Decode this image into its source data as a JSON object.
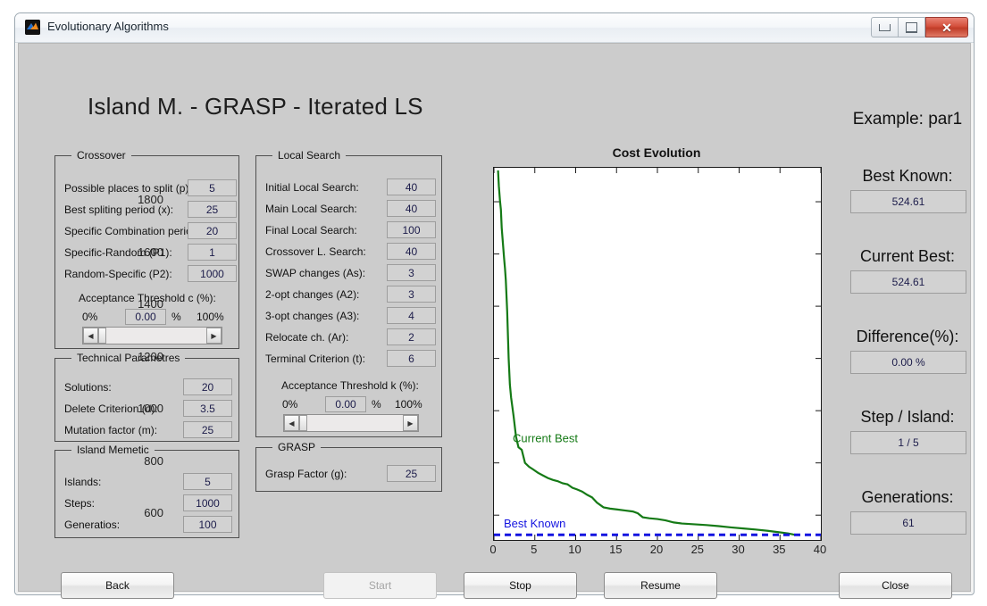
{
  "window": {
    "title": "Evolutionary Algorithms",
    "icon": "matlab-icon",
    "minimize": "minimize-icon",
    "maximize": "maximize-icon",
    "close": "close-icon"
  },
  "heading": "Island M. - GRASP - Iterated LS",
  "example": "Example: par1",
  "crossover": {
    "legend": "Crossover",
    "rows": [
      {
        "label": "Possible places to split (p):",
        "value": "5"
      },
      {
        "label": "Best spliting period (x):",
        "value": "25"
      },
      {
        "label": "Specific Combination period",
        "value": "20"
      },
      {
        "label": "Specific-Random (P1):",
        "value": "1"
      },
      {
        "label": "Random-Specific (P2):",
        "value": "1000"
      }
    ],
    "slider": {
      "title": "Acceptance Threshold c (%):",
      "min": "0%",
      "max": "100%",
      "value": "0.00",
      "unit": "%"
    }
  },
  "technical": {
    "legend": "Technical Parametres",
    "rows": [
      {
        "label": "Solutions:",
        "value": "20"
      },
      {
        "label": "Delete Criterion (d):",
        "value": "3.5"
      },
      {
        "label": "Mutation factor (m):",
        "value": "25"
      }
    ]
  },
  "island": {
    "legend": "Island Memetic",
    "rows": [
      {
        "label": "Islands:",
        "value": "5"
      },
      {
        "label": "Steps:",
        "value": "1000"
      },
      {
        "label": "Generatios:",
        "value": "100"
      }
    ]
  },
  "localsearch": {
    "legend": "Local Search",
    "rows": [
      {
        "label": "Initial Local Search:",
        "value": "40"
      },
      {
        "label": "Main Local Search:",
        "value": "40"
      },
      {
        "label": "Final Local Search:",
        "value": "100"
      },
      {
        "label": "Crossover L. Search:",
        "value": "40"
      },
      {
        "label": "SWAP changes (As):",
        "value": "3"
      },
      {
        "label": "2-opt changes (A2):",
        "value": "3"
      },
      {
        "label": "3-opt changes (A3):",
        "value": "4"
      },
      {
        "label": "Relocate ch. (Ar):",
        "value": "2"
      },
      {
        "label": "Terminal Criterion (t):",
        "value": "6"
      }
    ],
    "slider": {
      "title": "Acceptance Threshold k (%):",
      "min": "0%",
      "max": "100%",
      "value": "0.00",
      "unit": "%"
    }
  },
  "grasp": {
    "legend": "GRASP",
    "rows": [
      {
        "label": "Grasp Factor (g):",
        "value": "25"
      }
    ]
  },
  "info": [
    {
      "label": "Best Known:",
      "value": "524.61"
    },
    {
      "label": "Current Best:",
      "value": "524.61"
    },
    {
      "label": "Difference(%):",
      "value": "0.00 %"
    },
    {
      "label": "Step / Island:",
      "value": "1 / 5"
    },
    {
      "label": "Generations:",
      "value": "61"
    }
  ],
  "buttons": [
    {
      "label": "Back",
      "name": "back-button",
      "disabled": false
    },
    {
      "label": "Start",
      "name": "start-button",
      "disabled": true
    },
    {
      "label": "Stop",
      "name": "stop-button",
      "disabled": false
    },
    {
      "label": "Resume",
      "name": "resume-button",
      "disabled": false
    },
    {
      "label": "Close",
      "name": "close-button",
      "disabled": false
    }
  ],
  "colors": {
    "current_best": "#157a16",
    "best_known": "#1414e0",
    "panel": "#cccccc",
    "field": "#d2d2d2",
    "value_text": "#1c1c4a"
  },
  "chart_data": {
    "type": "line",
    "title": "Cost Evolution",
    "xlabel": "",
    "ylabel": "",
    "xlim": [
      0,
      40
    ],
    "ylim": [
      505,
      1930
    ],
    "xticks": [
      0,
      5,
      10,
      15,
      20,
      25,
      30,
      35,
      40
    ],
    "yticks": [
      600,
      800,
      1000,
      1200,
      1400,
      1600,
      1800
    ],
    "grid": false,
    "legend": "in-plot-annotations",
    "annotations": [
      {
        "text": "Current Best",
        "x": 2.3,
        "y": 880,
        "color": "#157a16"
      },
      {
        "text": "Best Known",
        "x": 1.2,
        "y": 553,
        "color": "#1414e0"
      }
    ],
    "series": [
      {
        "name": "Current Best",
        "color": "#157a16",
        "style": "solid",
        "x": [
          0.5,
          0.6,
          0.75,
          0.85,
          0.95,
          1.05,
          1.15,
          1.25,
          1.35,
          1.45,
          1.55,
          1.62,
          1.7,
          1.8,
          1.95,
          2.1,
          2.4,
          2.7,
          3.0,
          3.4,
          3.8,
          4.3,
          4.8,
          5.4,
          6.0,
          6.6,
          7.2,
          7.8,
          8.4,
          9.0,
          9.6,
          10.2,
          10.8,
          11.4,
          12.0,
          12.6,
          13.4,
          14.2,
          15.0,
          16.0,
          17.0,
          17.6,
          18.2,
          19.0,
          20.0,
          21.0,
          22.0,
          23.0,
          24.5,
          26.0,
          27.5,
          29.0,
          30.5,
          32.0,
          33.5,
          35.0,
          36.0,
          36.6,
          37.0
        ],
        "y": [
          1920,
          1860,
          1800,
          1770,
          1700,
          1660,
          1620,
          1580,
          1545,
          1500,
          1430,
          1380,
          1300,
          1200,
          1100,
          1050,
          980,
          900,
          860,
          850,
          800,
          785,
          775,
          762,
          752,
          742,
          735,
          730,
          722,
          718,
          705,
          698,
          690,
          678,
          668,
          648,
          630,
          625,
          622,
          618,
          614,
          607,
          592,
          588,
          585,
          580,
          572,
          568,
          565,
          562,
          558,
          553,
          549,
          545,
          540,
          534,
          530,
          526,
          524.61
        ]
      },
      {
        "name": "Best Known",
        "color": "#1414e0",
        "style": "dashed",
        "x": [
          0,
          40
        ],
        "y": [
          524.61,
          524.61
        ]
      }
    ]
  }
}
